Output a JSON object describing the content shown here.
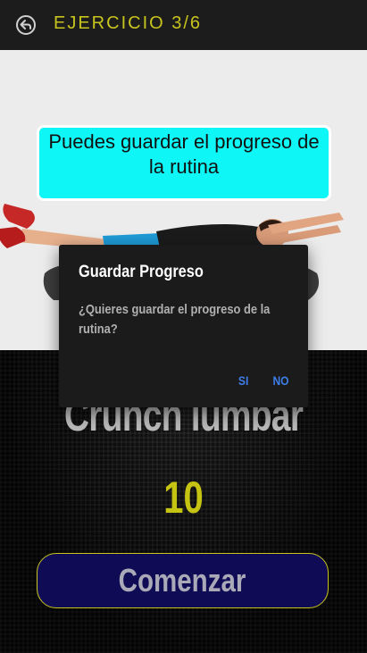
{
  "header": {
    "title": "EJERCICIO 3/6",
    "back_icon": "back-arrow-icon"
  },
  "exercise": {
    "name": "Crunch lumbar",
    "reps": "10"
  },
  "start_button": {
    "label": "Comenzar"
  },
  "tooltip": {
    "text": "Puedes guardar el progreso de la rutina"
  },
  "dialog": {
    "title": "Guardar Progreso",
    "message": "¿Quieres guardar el progreso de la rutina?",
    "yes_label": "SI",
    "no_label": "NO"
  },
  "colors": {
    "accent_yellow": "#c8c41e",
    "tooltip_cyan": "#0ff6f6",
    "button_blue": "#0f0b55",
    "dialog_action": "#3d7ee8"
  }
}
